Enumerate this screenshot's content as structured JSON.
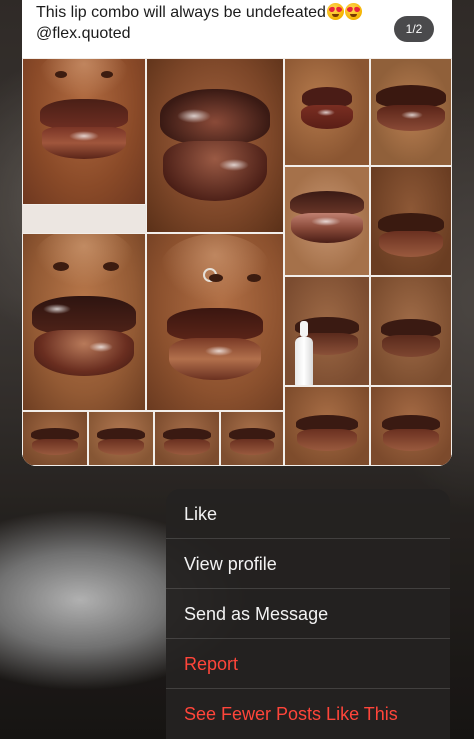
{
  "post": {
    "caption_text": "This lip combo will always be undefeated",
    "caption_emojis": [
      "heart-eyes-emoji",
      "heart-eyes-emoji"
    ],
    "caption_credit": "@flex.quoted",
    "page_indicator": "1/2",
    "image": {
      "description": "photo collage of glossy brown lip combos"
    }
  },
  "context_menu": {
    "items": [
      {
        "label": "Like",
        "style": "default"
      },
      {
        "label": "View profile",
        "style": "default"
      },
      {
        "label": "Send as Message",
        "style": "default"
      },
      {
        "label": "Report",
        "style": "destructive"
      },
      {
        "label": "See Fewer Posts Like This",
        "style": "destructive"
      }
    ]
  },
  "colors": {
    "menu_background": "#242221",
    "menu_text": "#f2f2f2",
    "destructive_text": "#ff453a",
    "badge_background": "#4a4a4c"
  }
}
